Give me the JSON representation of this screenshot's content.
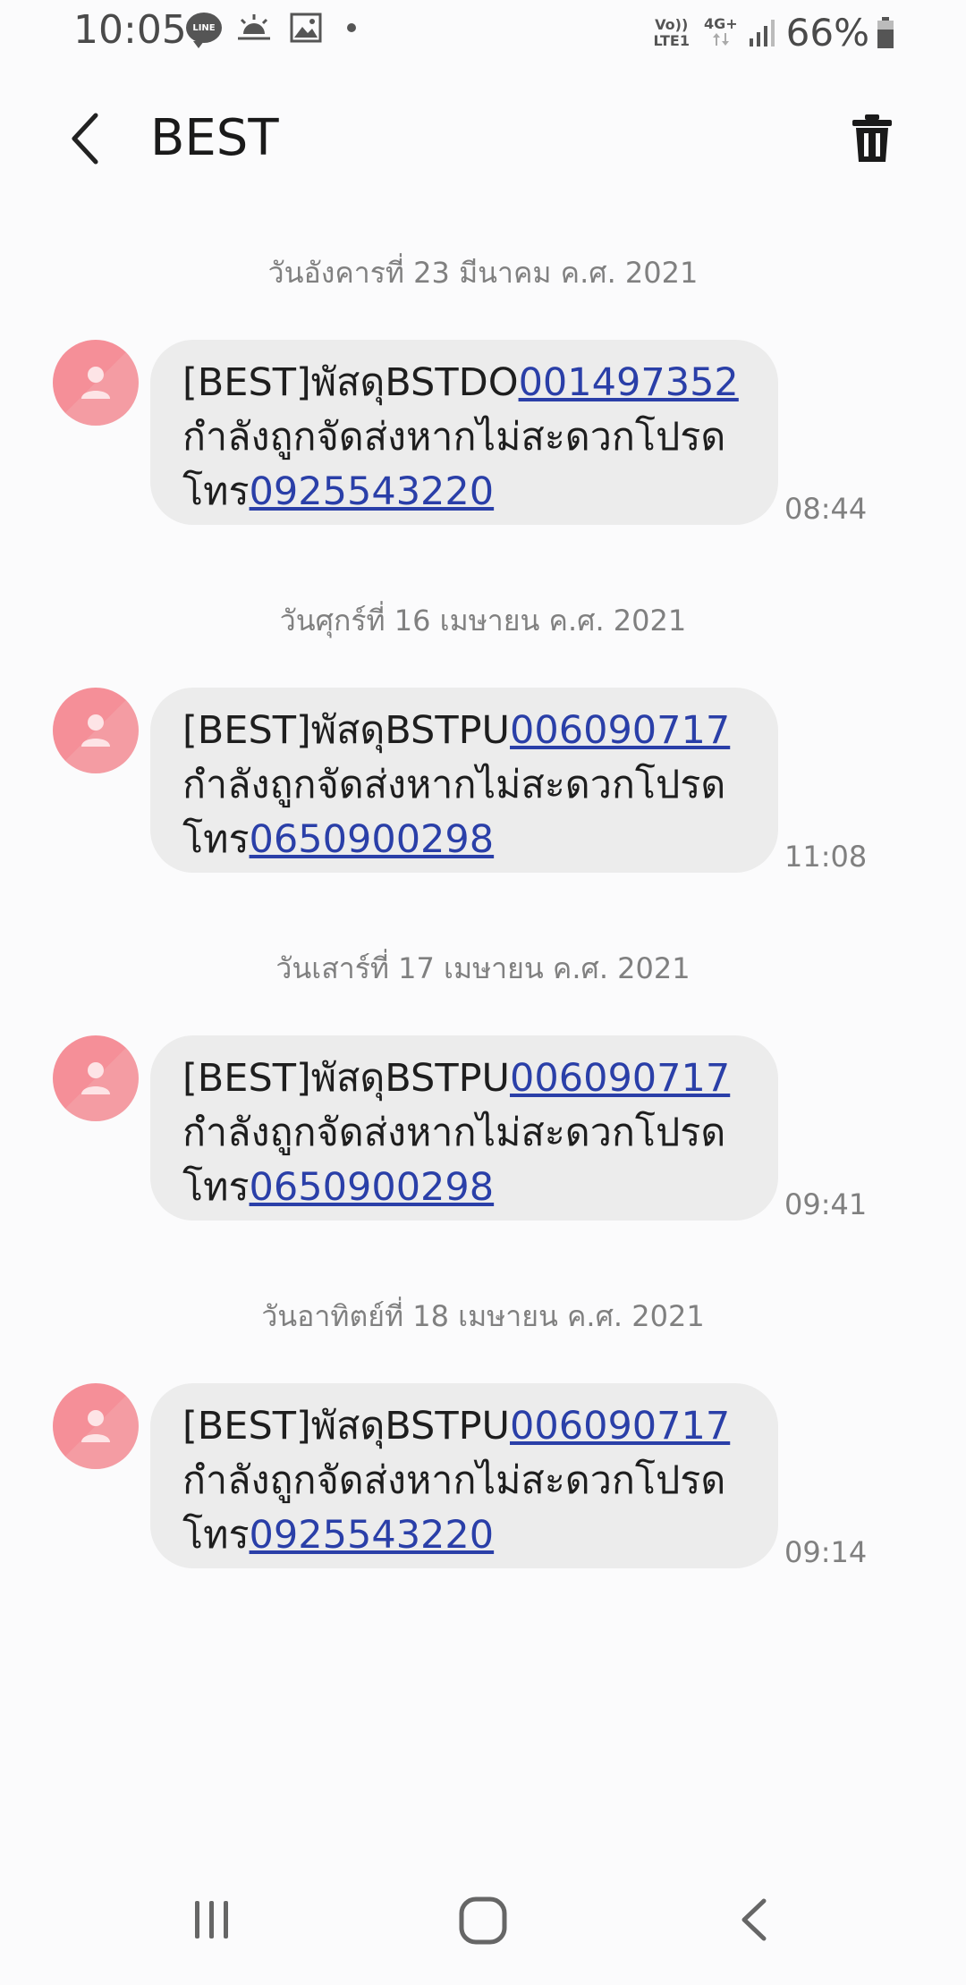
{
  "status_bar": {
    "time": "10:05",
    "line_label": "LINE",
    "volte_top": "Vo))",
    "volte_bottom": "LTE1",
    "network": "4G+",
    "battery": "66%"
  },
  "header": {
    "title": "BEST",
    "back_icon": "chevron-left-icon",
    "delete_icon": "trash-icon"
  },
  "colors": {
    "link": "#2a3fa8",
    "bubble": "#ececec",
    "avatar": "#f58f98"
  },
  "messages": [
    {
      "date": "วันอังคารที่ 23 มีนาคม ค.ศ. 2021",
      "text_prefix": "[BEST]พัสดุBSTDO",
      "tracking": "001497352",
      "text_middle": "กำลังถูกจัดส่งหากไม่สะดวกโปรด",
      "text_call": "โทร",
      "phone": "0925543220",
      "time": "08:44"
    },
    {
      "date": "วันศุกร์ที่ 16 เมษายน ค.ศ. 2021",
      "text_prefix": "[BEST]พัสดุBSTPU",
      "tracking": "006090717",
      "text_middle": "กำลังถูกจัดส่งหากไม่สะดวกโปรด",
      "text_call": "โทร",
      "phone": "0650900298",
      "time": "11:08"
    },
    {
      "date": "วันเสาร์ที่ 17 เมษายน ค.ศ. 2021",
      "text_prefix": "[BEST]พัสดุBSTPU",
      "tracking": "006090717",
      "text_middle": "กำลังถูกจัดส่งหากไม่สะดวกโปรด",
      "text_call": "โทร",
      "phone": "0650900298",
      "time": "09:41"
    },
    {
      "date": "วันอาทิตย์ที่ 18 เมษายน ค.ศ. 2021",
      "text_prefix": "[BEST]พัสดุBSTPU",
      "tracking": "006090717",
      "text_middle": "กำลังถูกจัดส่งหากไม่สะดวกโปรด",
      "text_call": "โทร",
      "phone": "0925543220",
      "time": "09:14"
    }
  ],
  "nav_bar": {
    "recents_icon": "recents-icon",
    "home_icon": "home-icon",
    "back_icon": "back-icon"
  }
}
